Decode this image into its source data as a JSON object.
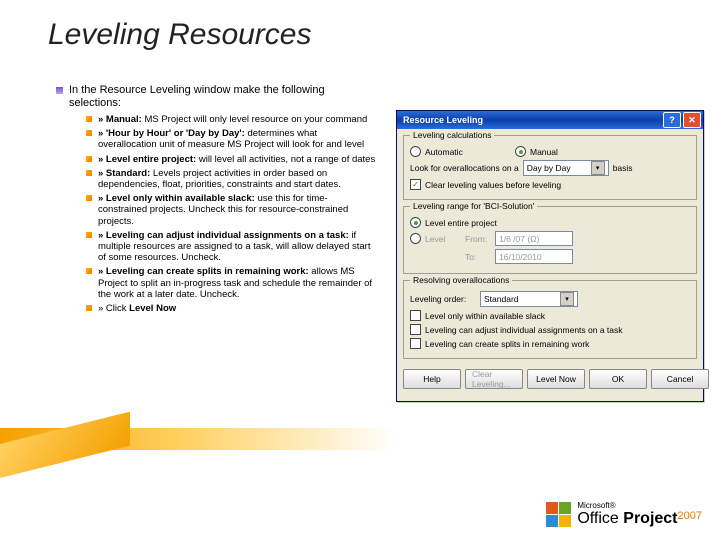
{
  "title": "Leveling Resources",
  "intro": "In the Resource Leveling window make the following selections:",
  "bullets": [
    {
      "bold": "» Manual:",
      "text": " MS Project will only level resource on your command"
    },
    {
      "bold": "» 'Hour by Hour' or 'Day by Day':",
      "text": " determines what overallocation unit of measure MS Project will look for and level"
    },
    {
      "bold": "» Level entire project:",
      "text": " will level all activities, not a range of dates"
    },
    {
      "bold": "» Standard:",
      "text": " Levels project activities in order based on dependencies, float, priorities, constraints and start dates."
    },
    {
      "bold": "» Level only within available slack:",
      "text": " use this for time-constrained projects. Uncheck this for resource-constrained projects."
    },
    {
      "bold": "» Leveling can adjust individual assignments on a task:",
      "text": " if multiple resources are assigned to a task, will allow delayed start of some resources. Uncheck."
    },
    {
      "bold": "» Leveling can create splits in remaining work:",
      "text": " allows MS Project to split an in-progress task and schedule the remainder of the work at a later date. Uncheck."
    },
    {
      "bold": "» Click",
      "text": " Level Now",
      "boldTrail": true
    }
  ],
  "dialog": {
    "title": "Resource Leveling",
    "group1": {
      "legend": "Leveling calculations",
      "automatic": "Automatic",
      "manual": "Manual",
      "lookLabel": "Look for overallocations on a",
      "lookValue": "Day by Day",
      "basis": "basis",
      "clear": "Clear leveling values before leveling"
    },
    "group2": {
      "legend": "Leveling range for 'BCI-Solution'",
      "entire": "Level entire project",
      "level": "Level",
      "from": "From:",
      "to": "To:",
      "fromDate": "1/6 /07 (Ω)",
      "toDate": "16/10/2010"
    },
    "group3": {
      "legend": "Resolving overallocations",
      "orderLabel": "Leveling order:",
      "orderValue": "Standard",
      "slack": "Level only within available slack",
      "adjust": "Leveling can adjust individual assignments on a task",
      "splits": "Leveling can create splits in remaining work"
    },
    "buttons": {
      "help": "Help",
      "clear": "Clear Leveling...",
      "now": "Level Now",
      "ok": "OK",
      "cancel": "Cancel"
    }
  },
  "logo": {
    "ms": "Microsoft®",
    "office": "Office ",
    "project": "Project",
    "year": "2007"
  }
}
